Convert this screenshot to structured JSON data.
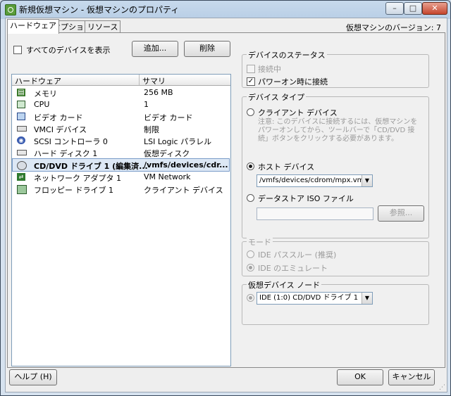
{
  "window": {
    "title": "新規仮想マシン - 仮想マシンのプロパティ",
    "caption_buttons": {
      "minimize": "–",
      "maximize": "□",
      "close": "✕"
    }
  },
  "tabs": [
    {
      "label": "ハードウェア",
      "active": true
    },
    {
      "label": "オプション",
      "active": false
    },
    {
      "label": "リソース",
      "active": false
    }
  ],
  "version_label": "仮想マシンのバージョン: 7",
  "hardware": {
    "show_all_label": "すべてのデバイスを表示",
    "show_all_checked": false,
    "add_button": "追加...",
    "remove_button": "削除",
    "columns": [
      "ハードウェア",
      "サマリ"
    ],
    "rows": [
      {
        "icon": "memory-icon",
        "name": "メモリ",
        "summary": "256 MB",
        "selected": false
      },
      {
        "icon": "cpu-icon",
        "name": "CPU",
        "summary": "1",
        "selected": false
      },
      {
        "icon": "video-card-icon",
        "name": "ビデオ カード",
        "summary": "ビデオ カード",
        "selected": false
      },
      {
        "icon": "vmci-icon",
        "name": "VMCI デバイス",
        "summary": "制限",
        "selected": false
      },
      {
        "icon": "scsi-controller-icon",
        "name": "SCSI コントローラ 0",
        "summary": "LSI Logic パラレル",
        "selected": false
      },
      {
        "icon": "hard-disk-icon",
        "name": "ハード ディスク 1",
        "summary": "仮想ディスク",
        "selected": false
      },
      {
        "icon": "cd-dvd-drive-icon",
        "name": "CD/DVD ドライブ 1 (編集済...",
        "summary": "/vmfs/devices/cdr...",
        "selected": true
      },
      {
        "icon": "network-adapter-icon",
        "name": "ネットワーク アダプタ 1",
        "summary": "VM Network",
        "selected": false
      },
      {
        "icon": "floppy-drive-icon",
        "name": "フロッピー ドライブ 1",
        "summary": "クライアント デバイス",
        "selected": false
      }
    ]
  },
  "device_status": {
    "title": "デバイスのステータス",
    "connected_label": "接続中",
    "connected_checked": false,
    "connected_enabled": false,
    "connect_at_power_on_label": "パワーオン時に接続",
    "connect_at_power_on_checked": true
  },
  "device_type": {
    "title": "デバイス タイプ",
    "client_device_label": "クライアント デバイス",
    "client_device_note": "注意: このデバイスに接続するには、仮想マシンをパワーオンしてから、ツールバーで「CD/DVD 接続」ボタンをクリックする必要があります。",
    "host_device_label": "ホスト デバイス",
    "host_device_value": "/vmfs/devices/cdrom/mpx.vmhba",
    "datastore_iso_label": "データストア ISO ファイル",
    "datastore_iso_value": "",
    "browse_button": "参照...",
    "selected": "host_device"
  },
  "mode": {
    "title": "モード",
    "passthrough_label": "IDE パススルー (推奨)",
    "emulate_label": "IDE のエミュレート",
    "selected": "emulate",
    "enabled": false
  },
  "virtual_device_node": {
    "title": "仮想デバイス ノード",
    "value": "IDE (1:0) CD/DVD ドライブ 1"
  },
  "footer": {
    "help_button": "ヘルプ (H)",
    "ok_button": "OK",
    "cancel_button": "キャンセル"
  }
}
